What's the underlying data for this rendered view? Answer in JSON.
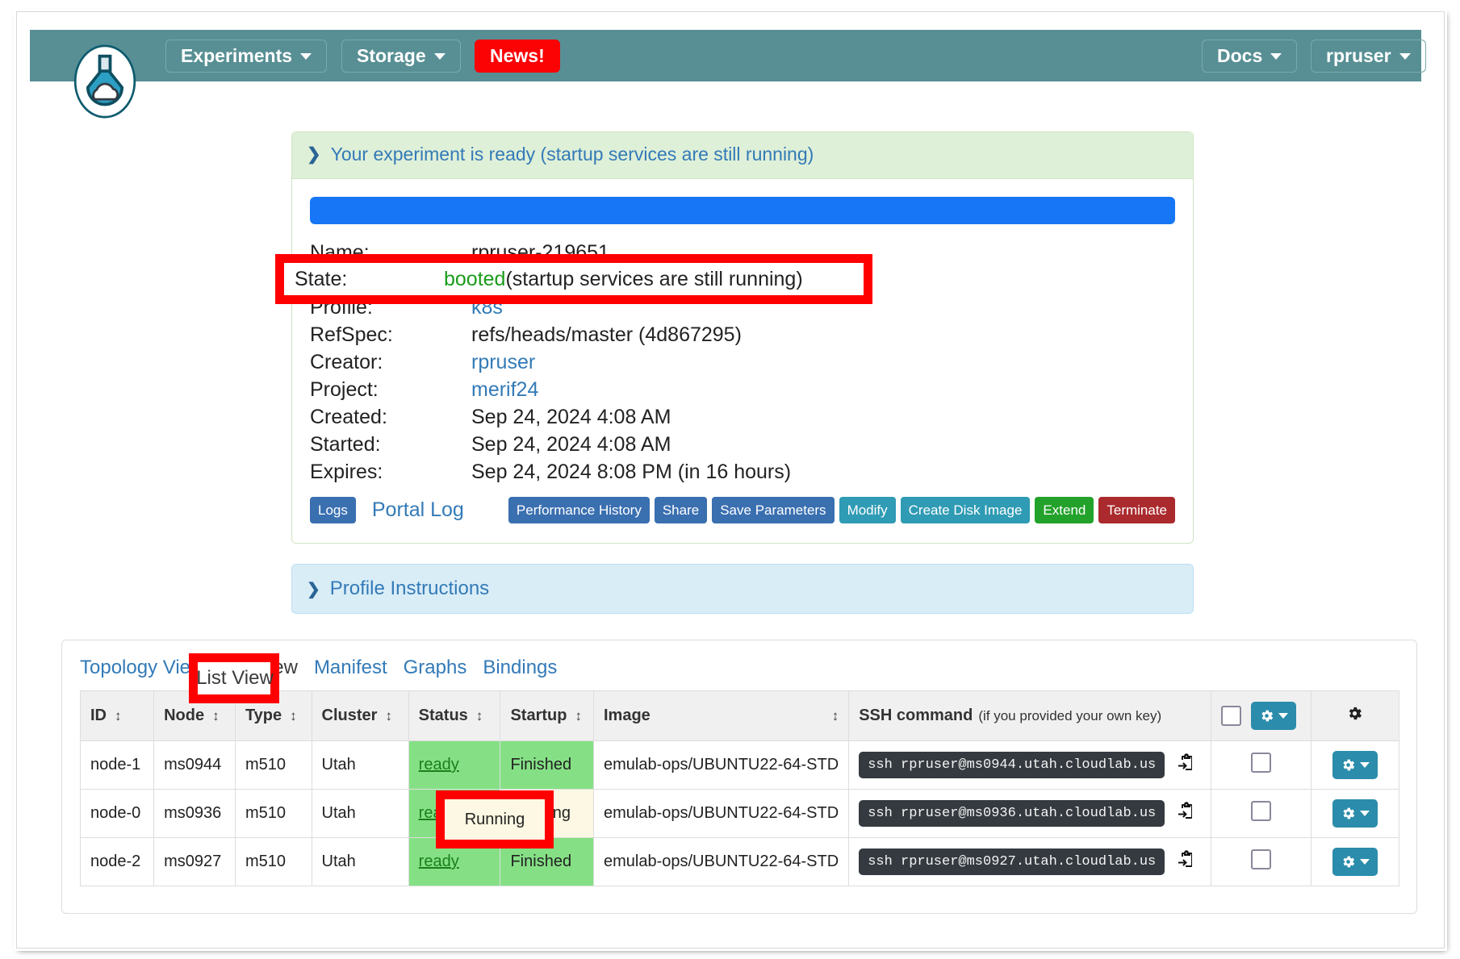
{
  "navbar": {
    "logo_icon": "cloudlab-flask-icon",
    "left_items": [
      {
        "label": "Experiments",
        "icon": "chevron-down-icon",
        "style": "plain"
      },
      {
        "label": "Storage",
        "icon": "chevron-down-icon",
        "style": "plain"
      },
      {
        "label": "News!",
        "icon": "",
        "style": "danger"
      }
    ],
    "right_items": [
      {
        "label": "Docs",
        "icon": "chevron-down-icon"
      },
      {
        "label": "rpruser",
        "icon": "chevron-down-icon"
      }
    ],
    "bg_color": "#578f94",
    "news_color": "#fb0205"
  },
  "ready_panel": {
    "toggle_icon": "chevron-down-icon",
    "heading": "Your experiment is ready (startup services are still running)",
    "progress_percent": 100,
    "progress_color": "#1676f5",
    "details": [
      {
        "label": "Name:",
        "value": "rpruser-219651",
        "kind": "text"
      },
      {
        "label": "State:",
        "value": "booted",
        "suffix": " (startup services are still running)",
        "kind": "state"
      },
      {
        "label": "Profile:",
        "value": "k8s",
        "kind": "link"
      },
      {
        "label": "RefSpec:",
        "value": "refs/heads/master (4d867295)",
        "kind": "text"
      },
      {
        "label": "Creator:",
        "value": "rpruser",
        "kind": "link"
      },
      {
        "label": "Project:",
        "value": "merif24",
        "kind": "link"
      },
      {
        "label": "Created:",
        "value": "Sep 24, 2024 4:08 AM",
        "kind": "text"
      },
      {
        "label": "Started:",
        "value": "Sep 24, 2024 4:08 AM",
        "kind": "text"
      },
      {
        "label": "Expires:",
        "value": "Sep 24, 2024 8:08 PM (in 16 hours)",
        "kind": "text"
      }
    ],
    "buttons": {
      "logs": "Logs",
      "portal_log": "Portal Log",
      "performance_history": "Performance History",
      "share": "Share",
      "save_parameters": "Save Parameters",
      "modify": "Modify",
      "create_disk_image": "Create Disk Image",
      "extend": "Extend",
      "terminate": "Terminate"
    }
  },
  "profile_instructions": {
    "toggle_icon": "chevron-right-icon",
    "label": "Profile Instructions"
  },
  "nodes_card": {
    "tabs": [
      {
        "label": "Topology View",
        "active": false
      },
      {
        "label": "List View",
        "active": true
      },
      {
        "label": "Manifest",
        "active": false
      },
      {
        "label": "Graphs",
        "active": false
      },
      {
        "label": "Bindings",
        "active": false
      }
    ],
    "columns": [
      {
        "label": "ID",
        "sortable": true
      },
      {
        "label": "Node",
        "sortable": true
      },
      {
        "label": "Type",
        "sortable": true
      },
      {
        "label": "Cluster",
        "sortable": true
      },
      {
        "label": "Status",
        "sortable": true
      },
      {
        "label": "Startup",
        "sortable": true
      },
      {
        "label": "Image",
        "sortable": true
      },
      {
        "label": "SSH command",
        "note": "(if you provided your own key)",
        "sortable": false
      }
    ],
    "header_controls": {
      "select_all_checkbox": "unchecked",
      "bulk_gear_icon": "gear-icon",
      "bulk_gear_caret": "chevron-down-icon",
      "settings_gear_icon": "gear-icon"
    },
    "rows": [
      {
        "id": "node-1",
        "node": "ms0944",
        "type": "m510",
        "cluster": "Utah",
        "status": "ready",
        "startup": "Finished",
        "startup_state": "finished",
        "image": "emulab-ops/UBUNTU22-64-STD",
        "ssh": "ssh rpruser@ms0944.utah.cloudlab.us",
        "paste_icon": "paste-icon",
        "checkbox": "unchecked",
        "gear_icon": "gear-icon"
      },
      {
        "id": "node-0",
        "node": "ms0936",
        "type": "m510",
        "cluster": "Utah",
        "status": "ready",
        "startup": "Running",
        "startup_state": "running",
        "image": "emulab-ops/UBUNTU22-64-STD",
        "ssh": "ssh rpruser@ms0936.utah.cloudlab.us",
        "paste_icon": "paste-icon",
        "checkbox": "unchecked",
        "gear_icon": "gear-icon"
      },
      {
        "id": "node-2",
        "node": "ms0927",
        "type": "m510",
        "cluster": "Utah",
        "status": "ready",
        "startup": "Finished",
        "startup_state": "finished",
        "image": "emulab-ops/UBUNTU22-64-STD",
        "ssh": "ssh rpruser@ms0927.utah.cloudlab.us",
        "paste_icon": "paste-icon",
        "checkbox": "unchecked",
        "gear_icon": "gear-icon"
      }
    ]
  },
  "annotations": {
    "color": "#fe0000",
    "boxes": [
      {
        "name": "state-row-highlight",
        "target": "State: booted (startup services are still running)"
      },
      {
        "name": "list-view-tab-highlight",
        "target": "List View"
      },
      {
        "name": "startup-running-highlight",
        "target": "Running"
      }
    ]
  },
  "colors": {
    "navbar": "#578f94",
    "accent_link": "#337ab7",
    "status_green": "#85e085",
    "startup_running": "#fcf8e3",
    "annotation_red": "#fe0000",
    "progress_blue": "#1676f5"
  }
}
